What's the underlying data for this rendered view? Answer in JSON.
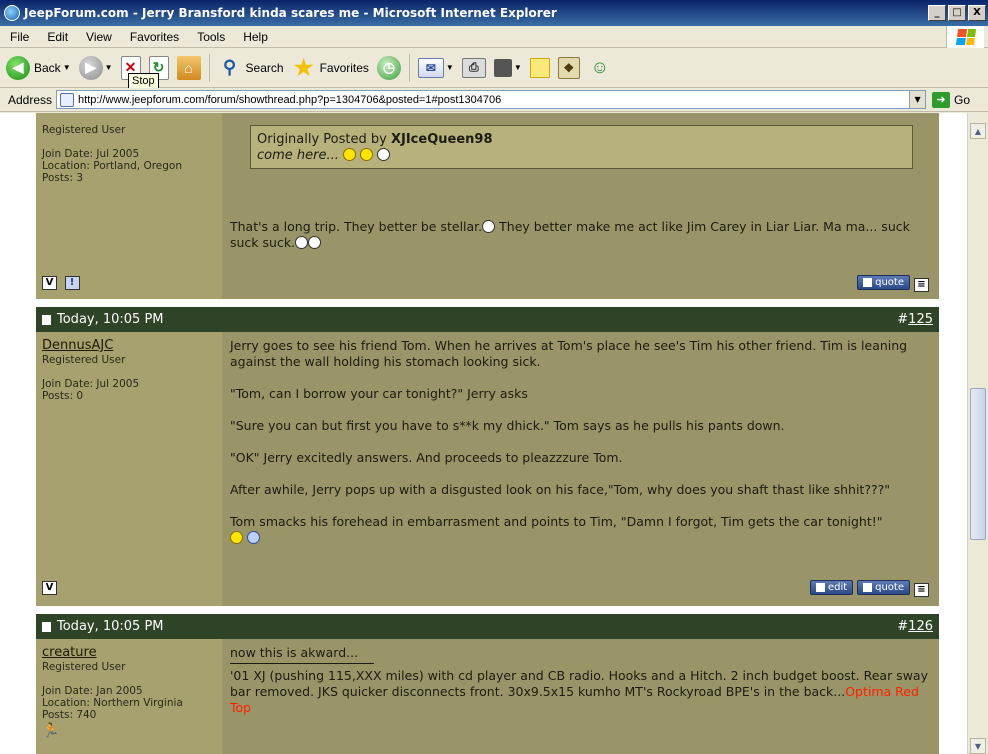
{
  "window": {
    "title": "JeepForum.com - Jerry Bransford kinda scares me - Microsoft Internet Explorer",
    "minimize": "_",
    "maximize": "□",
    "close": "X"
  },
  "menu": [
    "File",
    "Edit",
    "View",
    "Favorites",
    "Tools",
    "Help"
  ],
  "toolbar": {
    "back": "Back",
    "search": "Search",
    "favorites": "Favorites",
    "tooltip": "Stop"
  },
  "address": {
    "label": "Address",
    "url": "http://www.jeepforum.com/forum/showthread.php?p=1304706&posted=1#post1304706",
    "go": "Go"
  },
  "posts": [
    {
      "user": {
        "role": "Registered User",
        "join": "Join Date: Jul 2005",
        "location": "Location: Portland, Oregon",
        "posts": "Posts: 3"
      },
      "quote": {
        "by_label": "Originally Posted by",
        "author": "XJIceQueen98",
        "text": "come here..."
      },
      "text_a": "That's a long trip. They better be stellar.",
      "text_b": " They better make me act like Jim Carey in Liar Liar. Ma ma... suck suck suck.",
      "quote_btn": "quote"
    },
    {
      "date": "Today, 10:05 PM",
      "hash": "#",
      "number": "125",
      "user": {
        "name": "DennusAJC",
        "role": "Registered User",
        "join": "Join Date: Jul 2005",
        "posts": "Posts: 0"
      },
      "paragraphs": [
        "Jerry goes to see his friend Tom. When he arrives at Tom's place he see's Tim his other friend. Tim is leaning against the wall holding his stomach looking sick.",
        "\"Tom, can I borrow your car tonight?\" Jerry asks",
        "\"Sure you can but first you have to s**k my dhick.\" Tom says as he pulls his pants down.",
        "\"OK\" Jerry excitedly answers. And proceeds to pleazzzure Tom.",
        "After awhile, Jerry pops up with a disgusted look on his face,\"Tom, why does you shaft thast like shhit???\"",
        "Tom smacks his forehead in embarrasment and points to Tim, \"Damn I forgot, Tim gets the car tonight!\""
      ],
      "edit_btn": "edit",
      "quote_btn": "quote"
    },
    {
      "date": "Today, 10:05 PM",
      "hash": "#",
      "number": "126",
      "user": {
        "name": "creature",
        "role": "Registered User",
        "join": "Join Date: Jan 2005",
        "location": "Location: Northern Virginia",
        "posts": "Posts: 740"
      },
      "text": "now this is akward...",
      "signature": "'01 XJ (pushing 115,XXX miles) with cd player and CB radio. Hooks and a Hitch. 2 inch budget boost. Rear sway bar removed. JKS quicker disconnects front. 30x9.5x15 kumho MT's Rockyroad BPE's in the back...",
      "signature_link": "Optima Red Top"
    }
  ]
}
